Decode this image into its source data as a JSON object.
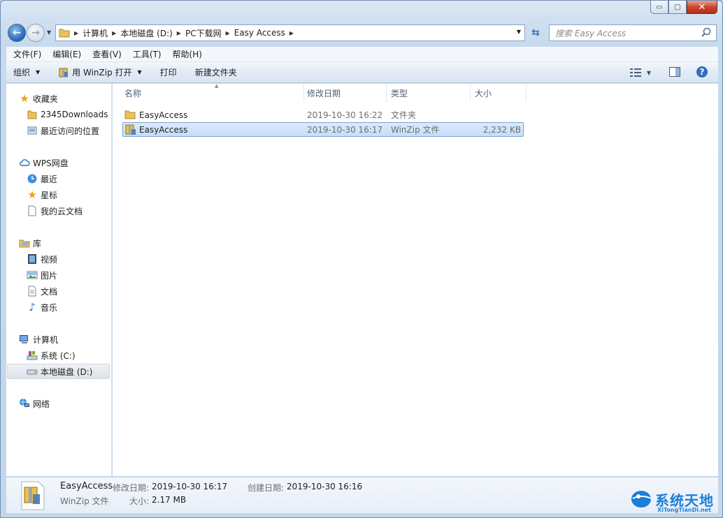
{
  "window": {
    "caption": {
      "minimize": "▭",
      "maximize": "□",
      "close": "✕"
    }
  },
  "address": {
    "crumbs": [
      "计算机",
      "本地磁盘 (D:)",
      "PC下载网",
      "Easy Access"
    ],
    "search_placeholder": "搜索 Easy Access"
  },
  "menu": [
    "文件(F)",
    "编辑(E)",
    "查看(V)",
    "工具(T)",
    "帮助(H)"
  ],
  "toolbar": {
    "organize": "组织",
    "open_with": "用 WinZip 打开",
    "print": "打印",
    "new_folder": "新建文件夹"
  },
  "nav": {
    "favorites": {
      "label": "收藏夹",
      "items": [
        "2345Downloads",
        "最近访问的位置"
      ]
    },
    "wps": {
      "label": "WPS网盘",
      "items": [
        "最近",
        "星标",
        "我的云文档"
      ]
    },
    "library": {
      "label": "库",
      "items": [
        "视频",
        "图片",
        "文档",
        "音乐"
      ]
    },
    "computer": {
      "label": "计算机",
      "items": [
        "系统 (C:)",
        "本地磁盘 (D:)"
      ]
    },
    "network": {
      "label": "网络"
    }
  },
  "columns": {
    "name": "名称",
    "modified": "修改日期",
    "type": "类型",
    "size": "大小"
  },
  "files": [
    {
      "name": "EasyAccess",
      "modified": "2019-10-30 16:22",
      "type": "文件夹",
      "size": "",
      "icon": "folder-icon"
    },
    {
      "name": "EasyAccess",
      "modified": "2019-10-30 16:17",
      "type": "WinZip 文件",
      "size": "2,232 KB",
      "icon": "zip-icon"
    }
  ],
  "details": {
    "name": "EasyAccess",
    "modified_label": "修改日期:",
    "modified": "2019-10-30 16:17",
    "created_label": "创建日期:",
    "created": "2019-10-30 16:16",
    "type": "WinZip 文件",
    "size_label": "大小:",
    "size": "2.17 MB"
  },
  "watermark": {
    "title": "系统天地",
    "url": "XiTongTianDi.net"
  },
  "colors": {
    "accent": "#2f6fbd",
    "selection": "#c4ddf9",
    "watermark": "#1a7ed8"
  }
}
